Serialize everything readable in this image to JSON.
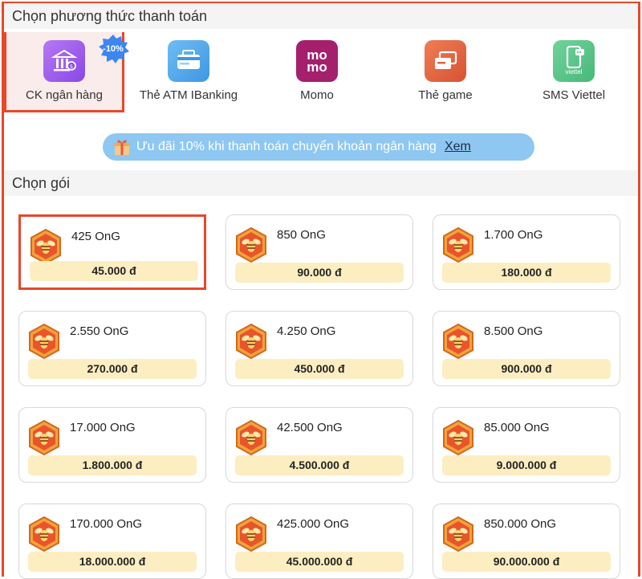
{
  "payment_section": {
    "title": "Chọn phương thức thanh toán"
  },
  "methods": [
    {
      "label": "CK ngân hàng",
      "icon": "bank-icon",
      "color": "#a45cf2",
      "selected": true,
      "badge": "-10%"
    },
    {
      "label": "Thẻ ATM IBanking",
      "icon": "atm-card-icon",
      "color": "#4fa9ec",
      "selected": false
    },
    {
      "label": "Momo",
      "icon": "momo-icon",
      "color": "#a4206d",
      "selected": false
    },
    {
      "label": "Thẻ game",
      "icon": "game-card-icon",
      "color": "#e2633f",
      "selected": false
    },
    {
      "label": "SMS Viettel",
      "icon": "viettel-sms-icon",
      "color": "#57c488",
      "selected": false
    }
  ],
  "momo_logo": {
    "line1": "mo",
    "line2": "mo"
  },
  "viettel_logo": {
    "text": "viettel"
  },
  "promo": {
    "text": "Ưu đãi 10% khi thanh toán chuyển khoản ngân hàng",
    "link": "Xem",
    "color": "#8ec7f1"
  },
  "package_section": {
    "title": "Chọn gói"
  },
  "packages": [
    {
      "amount": "425 OnG",
      "price": "45.000 đ",
      "selected": true
    },
    {
      "amount": "850 OnG",
      "price": "90.000 đ"
    },
    {
      "amount": "1.700 OnG",
      "price": "180.000 đ"
    },
    {
      "amount": "2.550 OnG",
      "price": "270.000 đ"
    },
    {
      "amount": "4.250 OnG",
      "price": "450.000 đ"
    },
    {
      "amount": "8.500 OnG",
      "price": "900.000 đ"
    },
    {
      "amount": "17.000 OnG",
      "price": "1.800.000 đ"
    },
    {
      "amount": "42.500 OnG",
      "price": "4.500.000 đ"
    },
    {
      "amount": "85.000 OnG",
      "price": "9.000.000 đ"
    },
    {
      "amount": "170.000 OnG",
      "price": "18.000.000 đ"
    },
    {
      "amount": "425.000 OnG",
      "price": "45.000.000 đ"
    },
    {
      "amount": "850.000 OnG",
      "price": "90.000.000 đ"
    }
  ],
  "accent_color": "#e8472a",
  "price_bg_color": "#fdeec2"
}
